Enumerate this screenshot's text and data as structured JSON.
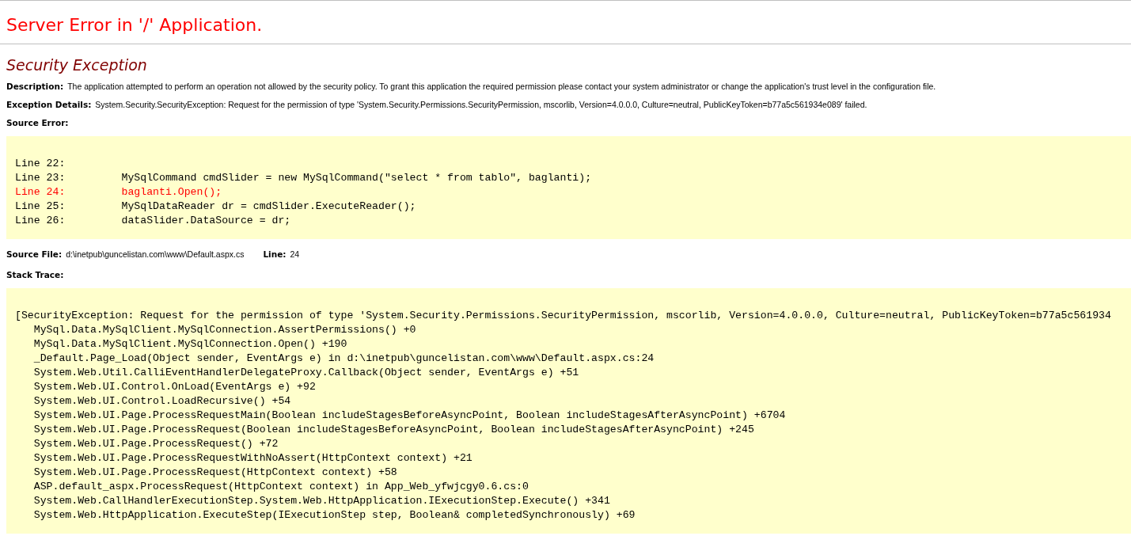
{
  "title": "Server Error in '/' Application.",
  "subtitle": "Security Exception",
  "description": {
    "label": "Description:",
    "text": "The application attempted to perform an operation not allowed by the security policy.  To grant this application the required permission please contact your system administrator or change the application's trust level in the configuration file."
  },
  "exception_details": {
    "label": "Exception Details:",
    "text": "System.Security.SecurityException: Request for the permission of type 'System.Security.Permissions.SecurityPermission, mscorlib, Version=4.0.0.0, Culture=neutral, PublicKeyToken=b77a5c561934e089' failed."
  },
  "source_error": {
    "label": "Source Error:",
    "lines": [
      {
        "text": "Line 22:",
        "highlighted": false
      },
      {
        "text": "Line 23:         MySqlCommand cmdSlider = new MySqlCommand(\"select * from tablo\", baglanti);",
        "highlighted": false
      },
      {
        "text": "Line 24:         baglanti.Open();",
        "highlighted": true
      },
      {
        "text": "Line 25:         MySqlDataReader dr = cmdSlider.ExecuteReader();",
        "highlighted": false
      },
      {
        "text": "Line 26:         dataSlider.DataSource = dr;",
        "highlighted": false
      }
    ]
  },
  "source_file": {
    "label": "Source File:",
    "value": "d:\\inetpub\\guncelistan.com\\www\\Default.aspx.cs",
    "line_label": "Line:",
    "line_value": "24"
  },
  "stack_trace": {
    "label": "Stack Trace:",
    "lines": [
      "[SecurityException: Request for the permission of type 'System.Security.Permissions.SecurityPermission, mscorlib, Version=4.0.0.0, Culture=neutral, PublicKeyToken=b77a5c561934",
      "   MySql.Data.MySqlClient.MySqlConnection.AssertPermissions() +0",
      "   MySql.Data.MySqlClient.MySqlConnection.Open() +190",
      "   _Default.Page_Load(Object sender, EventArgs e) in d:\\inetpub\\guncelistan.com\\www\\Default.aspx.cs:24",
      "   System.Web.Util.CalliEventHandlerDelegateProxy.Callback(Object sender, EventArgs e) +51",
      "   System.Web.UI.Control.OnLoad(EventArgs e) +92",
      "   System.Web.UI.Control.LoadRecursive() +54",
      "   System.Web.UI.Page.ProcessRequestMain(Boolean includeStagesBeforeAsyncPoint, Boolean includeStagesAfterAsyncPoint) +6704",
      "   System.Web.UI.Page.ProcessRequest(Boolean includeStagesBeforeAsyncPoint, Boolean includeStagesAfterAsyncPoint) +245",
      "   System.Web.UI.Page.ProcessRequest() +72",
      "   System.Web.UI.Page.ProcessRequestWithNoAssert(HttpContext context) +21",
      "   System.Web.UI.Page.ProcessRequest(HttpContext context) +58",
      "   ASP.default_aspx.ProcessRequest(HttpContext context) in App_Web_yfwjcgy0.6.cs:0",
      "   System.Web.CallHandlerExecutionStep.System.Web.HttpApplication.IExecutionStep.Execute() +341",
      "   System.Web.HttpApplication.ExecuteStep(IExecutionStep step, Boolean& completedSynchronously) +69"
    ]
  }
}
